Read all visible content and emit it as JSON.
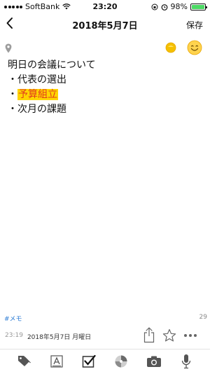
{
  "status_bar": {
    "carrier": "SoftBank",
    "time": "23:20",
    "battery": "98%",
    "battery_level": 0.98
  },
  "nav": {
    "title": "2018年5月7日",
    "save_label": "保存"
  },
  "note": {
    "lines": [
      "明日の会議について",
      "・代表の選出",
      "・",
      "予算組立",
      "・次月の課題"
    ]
  },
  "footer": {
    "tag": "#メモ",
    "char_count": "29",
    "time": "23:19",
    "date": "2018年5月7日 月曜日"
  },
  "icons": {
    "back": "chevron-left-icon",
    "location": "location-pin-icon",
    "mood": "mood-icon",
    "emoji": "smile-icon",
    "share": "share-icon",
    "favorite": "star-icon",
    "more": "more-icon",
    "tag": "tag-icon",
    "text": "text-format-icon",
    "checkbox": "checkbox-icon",
    "sticker": "sticker-icon",
    "camera": "camera-icon",
    "microphone": "microphone-icon"
  },
  "colors": {
    "highlight": "#ffd400",
    "highlight_text": "#e23b1f",
    "tag": "#2a7ad4",
    "battery": "#4cd964"
  }
}
